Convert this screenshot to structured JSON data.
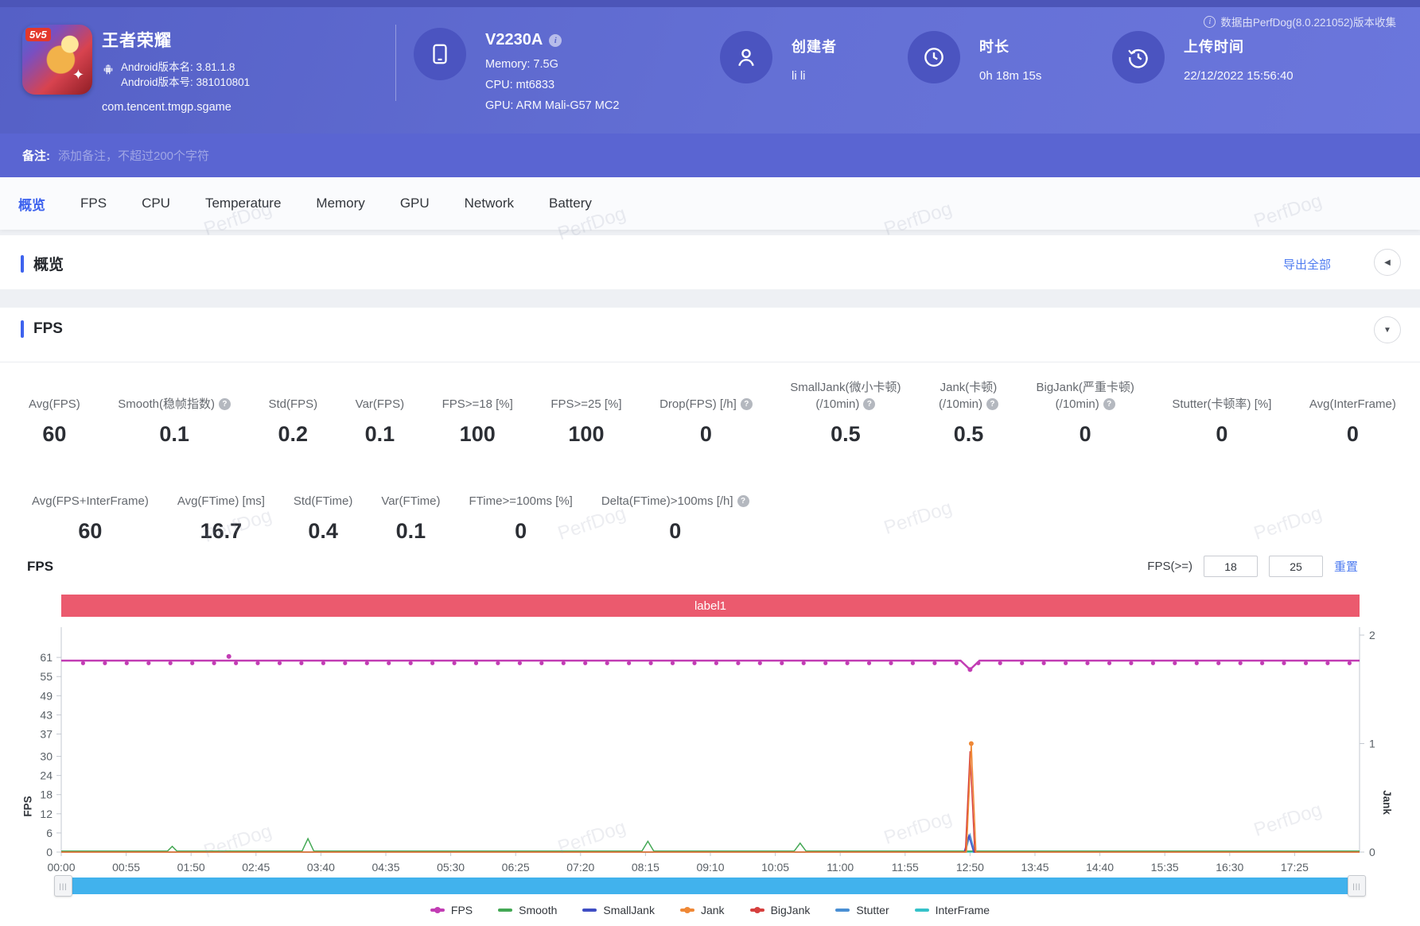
{
  "meta": {
    "watermark": "PerfDog",
    "collect_note": "数据由PerfDog(8.0.221052)版本收集"
  },
  "header": {
    "app": {
      "name": "王者荣耀",
      "badge": "5v5",
      "version_name": "Android版本名: 3.81.1.8",
      "version_code": "Android版本号: 381010801",
      "package": "com.tencent.tmgp.sgame"
    },
    "device": {
      "model": "V2230A",
      "memory": "Memory: 7.5G",
      "cpu": "CPU: mt6833",
      "gpu": "GPU: ARM Mali-G57 MC2"
    },
    "creator": {
      "label": "创建者",
      "value": "li li"
    },
    "duration": {
      "label": "时长",
      "value": "0h 18m 15s"
    },
    "upload": {
      "label": "上传时间",
      "value": "22/12/2022 15:56:40"
    }
  },
  "remark": {
    "label": "备注:",
    "placeholder": "添加备注，不超过200个字符"
  },
  "tabs": [
    {
      "label": "概览",
      "active": true
    },
    {
      "label": "FPS",
      "active": false
    },
    {
      "label": "CPU",
      "active": false
    },
    {
      "label": "Temperature",
      "active": false
    },
    {
      "label": "Memory",
      "active": false
    },
    {
      "label": "GPU",
      "active": false
    },
    {
      "label": "Network",
      "active": false
    },
    {
      "label": "Battery",
      "active": false
    }
  ],
  "overview": {
    "title": "概览",
    "export_label": "导出全部"
  },
  "fps_section": {
    "title": "FPS",
    "stats_row1": [
      {
        "label": "Avg(FPS)",
        "value": "60"
      },
      {
        "label": "Smooth(稳帧指数)",
        "value": "0.1",
        "help": true
      },
      {
        "label": "Std(FPS)",
        "value": "0.2"
      },
      {
        "label": "Var(FPS)",
        "value": "0.1"
      },
      {
        "label": "FPS>=18 [%]",
        "value": "100"
      },
      {
        "label": "FPS>=25 [%]",
        "value": "100"
      },
      {
        "label": "Drop(FPS) [/h]",
        "value": "0",
        "help": true
      },
      {
        "label": "SmallJank(微小卡顿)",
        "label2": "(/10min)",
        "value": "0.5",
        "help": true
      },
      {
        "label": "Jank(卡顿)",
        "label2": "(/10min)",
        "value": "0.5",
        "help": true
      },
      {
        "label": "BigJank(严重卡顿)",
        "label2": "(/10min)",
        "value": "0",
        "help": true
      },
      {
        "label": "Stutter(卡顿率) [%]",
        "value": "0"
      },
      {
        "label": "Avg(InterFrame)",
        "value": "0"
      }
    ],
    "stats_row2": [
      {
        "label": "Avg(FPS+InterFrame)",
        "value": "60"
      },
      {
        "label": "Avg(FTime) [ms]",
        "value": "16.7"
      },
      {
        "label": "Std(FTime)",
        "value": "0.4"
      },
      {
        "label": "Var(FTime)",
        "value": "0.1"
      },
      {
        "label": "FTime>=100ms [%]",
        "value": "0"
      },
      {
        "label": "Delta(FTime)>100ms [/h]",
        "value": "0",
        "help": true
      }
    ],
    "chart_title": "FPS",
    "chart_controls": {
      "filter_label": "FPS(>=)",
      "input1": "18",
      "input2": "25",
      "reset_label": "重置"
    },
    "chart_data": {
      "type": "line",
      "banner": {
        "text": "label1",
        "color": "#eb5a6e"
      },
      "left_axis": {
        "label": "FPS",
        "ticks": [
          61,
          55,
          49,
          43,
          37,
          30,
          24,
          18,
          12,
          6,
          0
        ],
        "max": 68
      },
      "right_axis": {
        "label": "Jank",
        "ticks": [
          2,
          1,
          0
        ],
        "max": 2
      },
      "x_axis": {
        "tick_labels": [
          "00:00",
          "00:55",
          "01:50",
          "02:45",
          "03:40",
          "04:35",
          "05:30",
          "06:25",
          "07:20",
          "08:15",
          "09:10",
          "10:05",
          "11:00",
          "11:55",
          "12:50",
          "13:45",
          "14:40",
          "15:35",
          "16:30",
          "17:25"
        ],
        "tick_interval_s": 55,
        "duration_s": 1100
      },
      "series": [
        {
          "name": "InterFrame",
          "axis": "left",
          "color": "#35c2c9",
          "width": 1.5,
          "points": [
            [
              0,
              0
            ],
            [
              1100,
              0
            ]
          ]
        },
        {
          "name": "Stutter",
          "axis": "right",
          "color": "#4a8fd4",
          "width": 1.5,
          "points": [
            [
              0,
              0
            ],
            [
              766,
              0
            ],
            [
              770,
              0.16
            ],
            [
              774,
              0
            ],
            [
              1100,
              0
            ]
          ]
        },
        {
          "name": "Smooth",
          "axis": "left",
          "color": "#43a854",
          "width": 1.5,
          "points": [
            [
              0,
              0.3
            ],
            [
              90,
              0.3
            ],
            [
              94,
              1.8
            ],
            [
              98,
              0.3
            ],
            [
              204,
              0.3
            ],
            [
              209,
              4.2
            ],
            [
              214,
              0.3
            ],
            [
              492,
              0.3
            ],
            [
              497,
              3.4
            ],
            [
              502,
              0.3
            ],
            [
              621,
              0.3
            ],
            [
              626,
              2.8
            ],
            [
              631,
              0.3
            ],
            [
              1100,
              0.3
            ]
          ]
        },
        {
          "name": "SmallJank",
          "axis": "right",
          "color": "#3f4ec4",
          "width": 1.5,
          "points": [
            [
              0,
              0
            ],
            [
              765,
              0
            ],
            [
              769,
              0.15
            ],
            [
              773,
              0
            ],
            [
              1100,
              0
            ]
          ]
        },
        {
          "name": "BigJank",
          "axis": "right",
          "color": "#d6403e",
          "width": 1.5,
          "points": [
            [
              0,
              0
            ],
            [
              766,
              0
            ],
            [
              770,
              0.93
            ],
            [
              774,
              0
            ],
            [
              1100,
              0
            ]
          ]
        },
        {
          "name": "Jank",
          "axis": "right",
          "color": "#ef8836",
          "width": 1.5,
          "points": [
            [
              0,
              0
            ],
            [
              767,
              0
            ],
            [
              771,
              1.0
            ],
            [
              775,
              0
            ],
            [
              1100,
              0
            ]
          ],
          "markers": [
            [
              771,
              1.0
            ]
          ]
        },
        {
          "name": "FPS",
          "axis": "left",
          "color": "#c23db4",
          "width": 2.5,
          "points": [
            [
              0,
              60
            ],
            [
              762,
              60
            ],
            [
              770,
              57.2
            ],
            [
              778,
              60
            ],
            [
              1100,
              60
            ]
          ],
          "marker_interval_s": 18.5,
          "marker_y": 59.2,
          "markers": [
            [
              142,
              61.3
            ],
            [
              770,
              57.2
            ]
          ]
        }
      ],
      "legend": [
        {
          "name": "FPS",
          "color": "#c23db4",
          "dot": true
        },
        {
          "name": "Smooth",
          "color": "#43a854",
          "dot": false
        },
        {
          "name": "SmallJank",
          "color": "#3f4ec4",
          "dot": false
        },
        {
          "name": "Jank",
          "color": "#ef8836",
          "dot": true
        },
        {
          "name": "BigJank",
          "color": "#d6403e",
          "dot": true
        },
        {
          "name": "Stutter",
          "color": "#4a8fd4",
          "dot": false
        },
        {
          "name": "InterFrame",
          "color": "#35c2c9",
          "dot": false
        }
      ]
    }
  }
}
